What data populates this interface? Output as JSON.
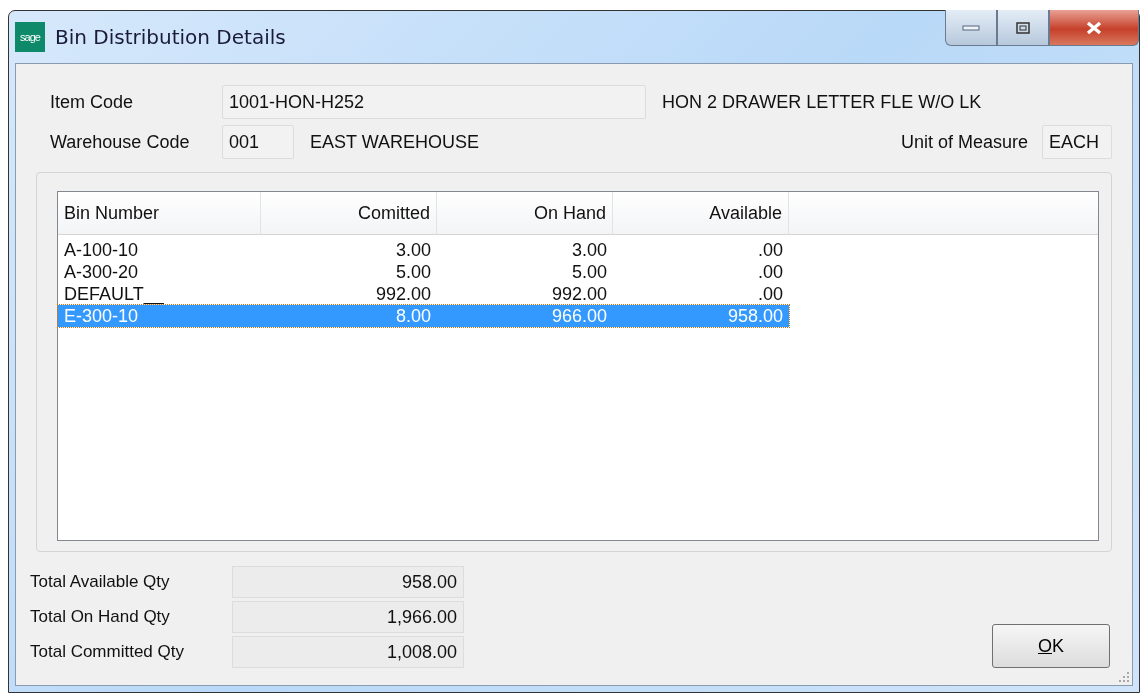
{
  "window": {
    "title": "Bin Distribution Details",
    "logo_text": "sage"
  },
  "item_code": {
    "label": "Item Code",
    "value": "1001-HON-H252",
    "description": "HON 2 DRAWER LETTER FLE W/O LK"
  },
  "warehouse_code": {
    "label": "Warehouse Code",
    "value": "001",
    "description": "EAST WAREHOUSE"
  },
  "unit_of_measure": {
    "label": "Unit of Measure",
    "value": "EACH"
  },
  "table": {
    "columns": [
      "Bin Number",
      "Comitted",
      "On Hand",
      "Available"
    ],
    "rows": [
      {
        "cells": [
          "A-100-10",
          "3.00",
          "3.00",
          ".00"
        ],
        "selected": false
      },
      {
        "cells": [
          "A-300-20",
          "5.00",
          "5.00",
          ".00"
        ],
        "selected": false
      },
      {
        "cells": [
          "DEFAULT__",
          "992.00",
          "992.00",
          ".00"
        ],
        "selected": false
      },
      {
        "cells": [
          "E-300-10",
          "8.00",
          "966.00",
          "958.00"
        ],
        "selected": true
      }
    ]
  },
  "totals": [
    {
      "label": "Total Available Qty",
      "value": "958.00"
    },
    {
      "label": "Total On Hand Qty",
      "value": "1,966.00"
    },
    {
      "label": "Total Committed Qty",
      "value": "1,008.00"
    }
  ],
  "buttons": [
    "OK"
  ]
}
